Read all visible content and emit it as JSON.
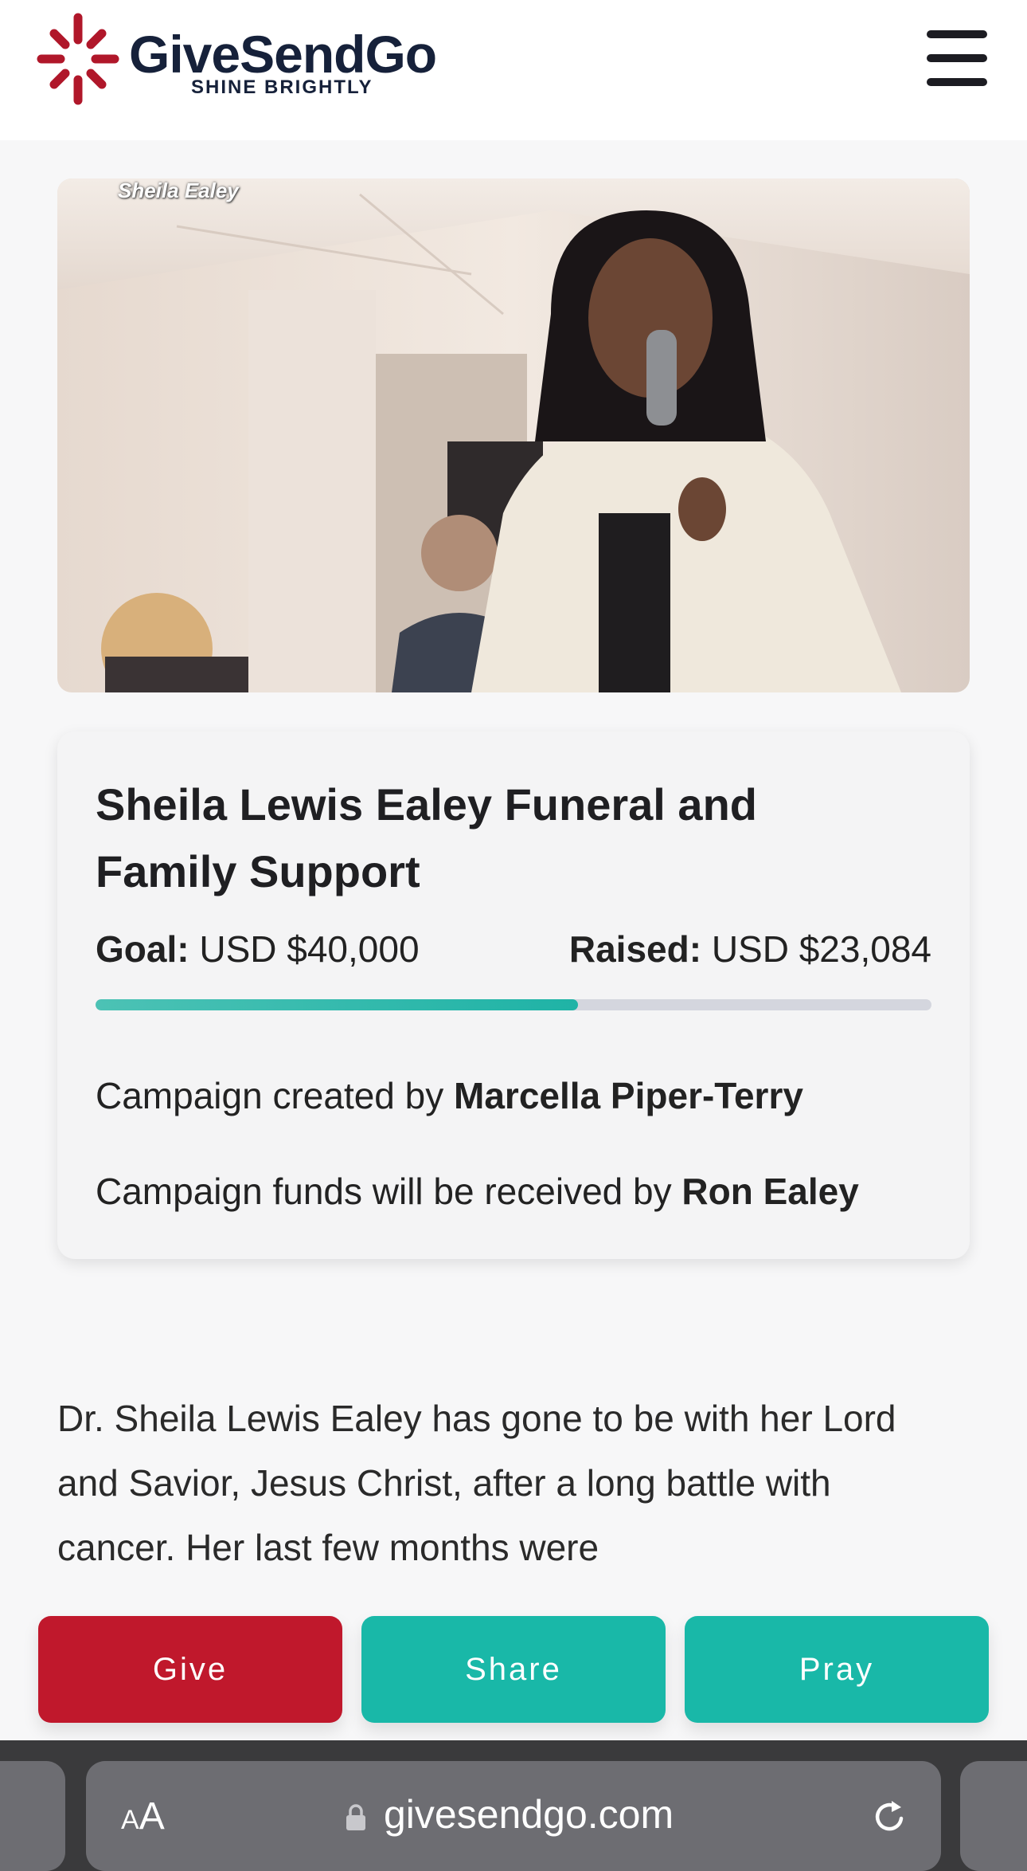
{
  "header": {
    "logo_name": "GiveSendGo",
    "logo_tagline": "SHINE BRIGHTLY",
    "menu_icon": "hamburger-menu-icon"
  },
  "hero": {
    "caption": "Sheila Ealey"
  },
  "campaign": {
    "title": "Sheila Lewis Ealey Funeral and Family Support",
    "goal_label": "Goal:",
    "goal_value": "USD $40,000",
    "raised_label": "Raised:",
    "raised_value": "USD $23,084",
    "progress_fraction": 0.577,
    "created_by_prefix": "Campaign created by",
    "created_by_name": "Marcella Piper-Terry",
    "received_by_prefix": "Campaign funds will be received by",
    "received_by_name": "Ron Ealey"
  },
  "story": {
    "text": "Dr. Sheila Lewis Ealey has gone to be with her Lord and Savior, Jesus Christ, after a long battle with cancer. Her last few months were"
  },
  "actions": {
    "give": "Give",
    "share": "Share",
    "pray": "Pray"
  },
  "browser": {
    "text_size_small": "A",
    "text_size_large": "A",
    "url": "givesendgo.com",
    "lock_icon": "lock-icon",
    "reload_icon": "reload-icon"
  },
  "colors": {
    "brand_red": "#c0182c",
    "brand_teal": "#19b8a8",
    "brand_navy": "#16213a"
  }
}
